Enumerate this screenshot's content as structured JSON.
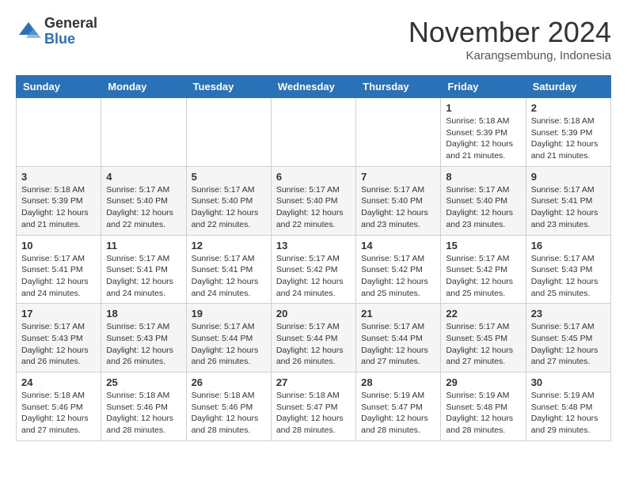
{
  "header": {
    "logo": {
      "general": "General",
      "blue": "Blue"
    },
    "title": "November 2024",
    "location": "Karangsembung, Indonesia"
  },
  "weekdays": [
    "Sunday",
    "Monday",
    "Tuesday",
    "Wednesday",
    "Thursday",
    "Friday",
    "Saturday"
  ],
  "weeks": [
    [
      {
        "day": "",
        "sunrise": "",
        "sunset": "",
        "daylight": ""
      },
      {
        "day": "",
        "sunrise": "",
        "sunset": "",
        "daylight": ""
      },
      {
        "day": "",
        "sunrise": "",
        "sunset": "",
        "daylight": ""
      },
      {
        "day": "",
        "sunrise": "",
        "sunset": "",
        "daylight": ""
      },
      {
        "day": "",
        "sunrise": "",
        "sunset": "",
        "daylight": ""
      },
      {
        "day": "1",
        "sunrise": "Sunrise: 5:18 AM",
        "sunset": "Sunset: 5:39 PM",
        "daylight": "Daylight: 12 hours and 21 minutes."
      },
      {
        "day": "2",
        "sunrise": "Sunrise: 5:18 AM",
        "sunset": "Sunset: 5:39 PM",
        "daylight": "Daylight: 12 hours and 21 minutes."
      }
    ],
    [
      {
        "day": "3",
        "sunrise": "Sunrise: 5:18 AM",
        "sunset": "Sunset: 5:39 PM",
        "daylight": "Daylight: 12 hours and 21 minutes."
      },
      {
        "day": "4",
        "sunrise": "Sunrise: 5:17 AM",
        "sunset": "Sunset: 5:40 PM",
        "daylight": "Daylight: 12 hours and 22 minutes."
      },
      {
        "day": "5",
        "sunrise": "Sunrise: 5:17 AM",
        "sunset": "Sunset: 5:40 PM",
        "daylight": "Daylight: 12 hours and 22 minutes."
      },
      {
        "day": "6",
        "sunrise": "Sunrise: 5:17 AM",
        "sunset": "Sunset: 5:40 PM",
        "daylight": "Daylight: 12 hours and 22 minutes."
      },
      {
        "day": "7",
        "sunrise": "Sunrise: 5:17 AM",
        "sunset": "Sunset: 5:40 PM",
        "daylight": "Daylight: 12 hours and 23 minutes."
      },
      {
        "day": "8",
        "sunrise": "Sunrise: 5:17 AM",
        "sunset": "Sunset: 5:40 PM",
        "daylight": "Daylight: 12 hours and 23 minutes."
      },
      {
        "day": "9",
        "sunrise": "Sunrise: 5:17 AM",
        "sunset": "Sunset: 5:41 PM",
        "daylight": "Daylight: 12 hours and 23 minutes."
      }
    ],
    [
      {
        "day": "10",
        "sunrise": "Sunrise: 5:17 AM",
        "sunset": "Sunset: 5:41 PM",
        "daylight": "Daylight: 12 hours and 24 minutes."
      },
      {
        "day": "11",
        "sunrise": "Sunrise: 5:17 AM",
        "sunset": "Sunset: 5:41 PM",
        "daylight": "Daylight: 12 hours and 24 minutes."
      },
      {
        "day": "12",
        "sunrise": "Sunrise: 5:17 AM",
        "sunset": "Sunset: 5:41 PM",
        "daylight": "Daylight: 12 hours and 24 minutes."
      },
      {
        "day": "13",
        "sunrise": "Sunrise: 5:17 AM",
        "sunset": "Sunset: 5:42 PM",
        "daylight": "Daylight: 12 hours and 24 minutes."
      },
      {
        "day": "14",
        "sunrise": "Sunrise: 5:17 AM",
        "sunset": "Sunset: 5:42 PM",
        "daylight": "Daylight: 12 hours and 25 minutes."
      },
      {
        "day": "15",
        "sunrise": "Sunrise: 5:17 AM",
        "sunset": "Sunset: 5:42 PM",
        "daylight": "Daylight: 12 hours and 25 minutes."
      },
      {
        "day": "16",
        "sunrise": "Sunrise: 5:17 AM",
        "sunset": "Sunset: 5:43 PM",
        "daylight": "Daylight: 12 hours and 25 minutes."
      }
    ],
    [
      {
        "day": "17",
        "sunrise": "Sunrise: 5:17 AM",
        "sunset": "Sunset: 5:43 PM",
        "daylight": "Daylight: 12 hours and 26 minutes."
      },
      {
        "day": "18",
        "sunrise": "Sunrise: 5:17 AM",
        "sunset": "Sunset: 5:43 PM",
        "daylight": "Daylight: 12 hours and 26 minutes."
      },
      {
        "day": "19",
        "sunrise": "Sunrise: 5:17 AM",
        "sunset": "Sunset: 5:44 PM",
        "daylight": "Daylight: 12 hours and 26 minutes."
      },
      {
        "day": "20",
        "sunrise": "Sunrise: 5:17 AM",
        "sunset": "Sunset: 5:44 PM",
        "daylight": "Daylight: 12 hours and 26 minutes."
      },
      {
        "day": "21",
        "sunrise": "Sunrise: 5:17 AM",
        "sunset": "Sunset: 5:44 PM",
        "daylight": "Daylight: 12 hours and 27 minutes."
      },
      {
        "day": "22",
        "sunrise": "Sunrise: 5:17 AM",
        "sunset": "Sunset: 5:45 PM",
        "daylight": "Daylight: 12 hours and 27 minutes."
      },
      {
        "day": "23",
        "sunrise": "Sunrise: 5:17 AM",
        "sunset": "Sunset: 5:45 PM",
        "daylight": "Daylight: 12 hours and 27 minutes."
      }
    ],
    [
      {
        "day": "24",
        "sunrise": "Sunrise: 5:18 AM",
        "sunset": "Sunset: 5:46 PM",
        "daylight": "Daylight: 12 hours and 27 minutes."
      },
      {
        "day": "25",
        "sunrise": "Sunrise: 5:18 AM",
        "sunset": "Sunset: 5:46 PM",
        "daylight": "Daylight: 12 hours and 28 minutes."
      },
      {
        "day": "26",
        "sunrise": "Sunrise: 5:18 AM",
        "sunset": "Sunset: 5:46 PM",
        "daylight": "Daylight: 12 hours and 28 minutes."
      },
      {
        "day": "27",
        "sunrise": "Sunrise: 5:18 AM",
        "sunset": "Sunset: 5:47 PM",
        "daylight": "Daylight: 12 hours and 28 minutes."
      },
      {
        "day": "28",
        "sunrise": "Sunrise: 5:19 AM",
        "sunset": "Sunset: 5:47 PM",
        "daylight": "Daylight: 12 hours and 28 minutes."
      },
      {
        "day": "29",
        "sunrise": "Sunrise: 5:19 AM",
        "sunset": "Sunset: 5:48 PM",
        "daylight": "Daylight: 12 hours and 28 minutes."
      },
      {
        "day": "30",
        "sunrise": "Sunrise: 5:19 AM",
        "sunset": "Sunset: 5:48 PM",
        "daylight": "Daylight: 12 hours and 29 minutes."
      }
    ]
  ]
}
